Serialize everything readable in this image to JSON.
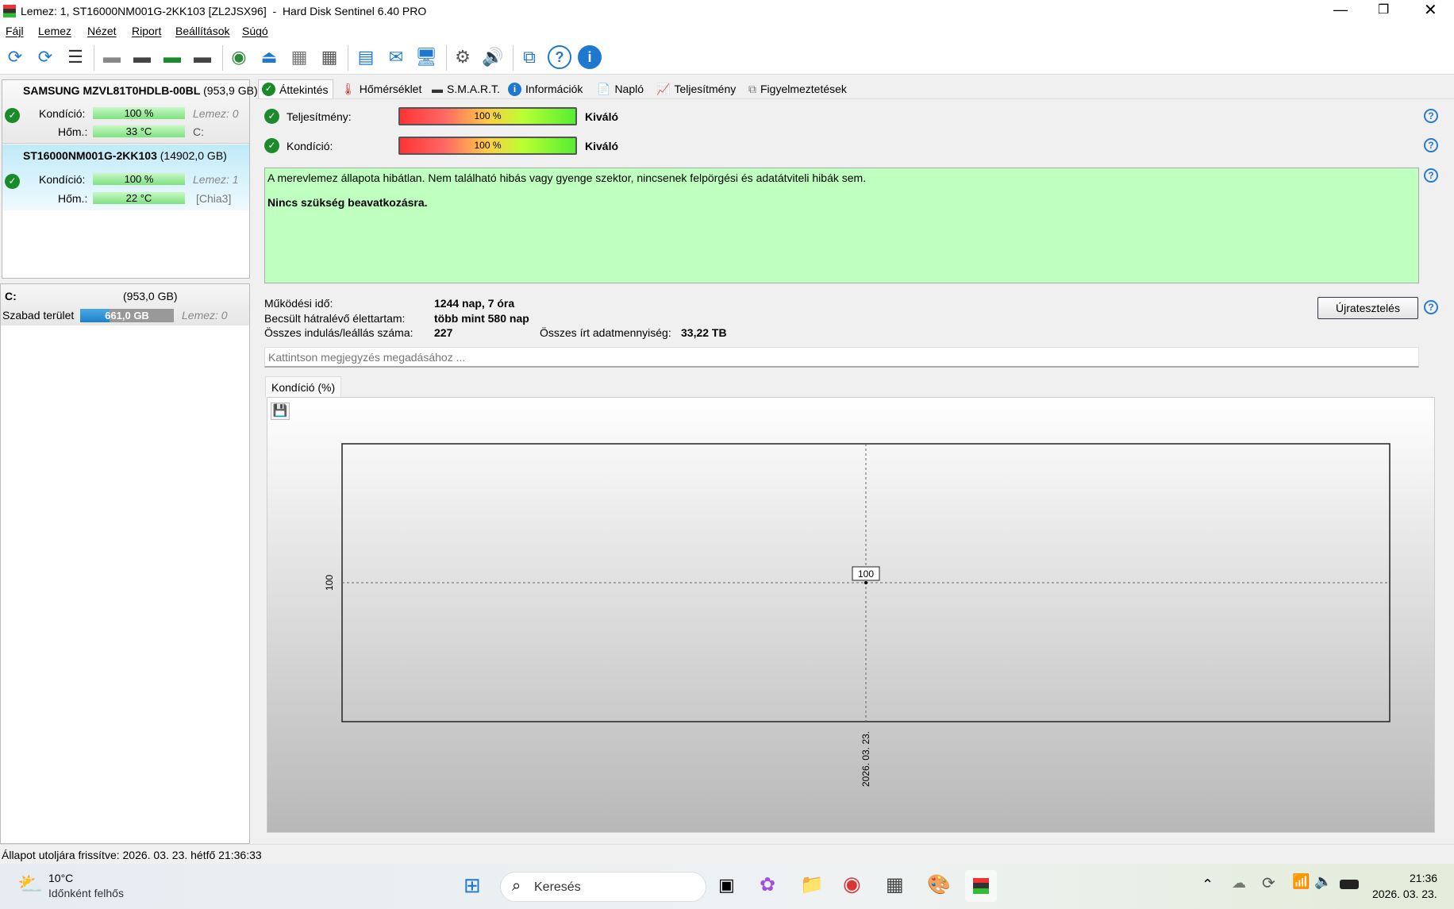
{
  "window": {
    "title": "Lemez: 1, ST16000NM001G-2KK103 [ZL2JSX96]  -  Hard Disk Sentinel 6.40 PRO"
  },
  "menu": [
    "Fájl",
    "Lemez",
    "Nézet",
    "Riport",
    "Beállítások",
    "Súgó"
  ],
  "disks": [
    {
      "name": "SAMSUNG MZVL81T0HDLB-00BL",
      "size": "(953,9 GB)",
      "condition_label": "Kondíció:",
      "condition": "100 %",
      "temp_label": "Hőm.:",
      "temp": "33 °C",
      "disk_label": "Lemez: 0",
      "extra": "C:"
    },
    {
      "name": "ST16000NM001G-2KK103",
      "size": "(14902,0 GB)",
      "condition_label": "Kondíció:",
      "condition": "100 %",
      "temp_label": "Hőm.:",
      "temp": "22 °C",
      "disk_label": "Lemez: 1",
      "extra": "[Chia3]"
    }
  ],
  "partition": {
    "name": "C:",
    "size": "(953,0 GB)",
    "free_label": "Szabad terület",
    "free": "661,0 GB",
    "free_fraction": 0.31,
    "disk_label": "Lemez: 0"
  },
  "tabs": [
    "Áttekintés",
    "Hőmérséklet",
    "S.M.A.R.T.",
    "Információk",
    "Napló",
    "Teljesítmény",
    "Figyelmeztetések"
  ],
  "overview": {
    "performance_label": "Teljesítmény:",
    "performance": "100 %",
    "performance_text": "Kiváló",
    "condition_label": "Kondíció:",
    "condition": "100 %",
    "condition_text": "Kiváló",
    "message": "A merevlemez állapota hibátlan. Nem található hibás vagy gyenge szektor, nincsenek felpörgési és adatátviteli hibák sem.",
    "message_bold": "Nincs szükség beavatkozásra.",
    "uptime_label": "Működési idő:",
    "uptime": "1244 nap, 7 óra",
    "remaining_label": "Becsült hátralévő élettartam:",
    "remaining": "több mint 580 nap",
    "starts_label": "Összes indulás/leállás száma:",
    "starts": "227",
    "written_label": "Összes írt adatmennyiség:",
    "written": "33,22 TB",
    "retest_button": "Újratesztelés",
    "note_placeholder": "Kattintson megjegyzés megadásához ...",
    "chart_tab": "Kondíció  (%)"
  },
  "chart_data": {
    "type": "line",
    "title": "Kondíció (%)",
    "x": [
      "2026. 03. 23."
    ],
    "series": [
      {
        "name": "Kondíció",
        "values": [
          100
        ]
      }
    ],
    "ytick": "100",
    "point_label": "100",
    "xlabel": "",
    "ylabel": ""
  },
  "status": "Állapot utoljára frissítve: 2026. 03. 23. hétfő 21:36:33",
  "taskbar": {
    "weather_temp": "10°C",
    "weather_text": "Időnként felhős",
    "search": "Keresés",
    "time": "21:36",
    "date": "2026. 03. 23."
  }
}
